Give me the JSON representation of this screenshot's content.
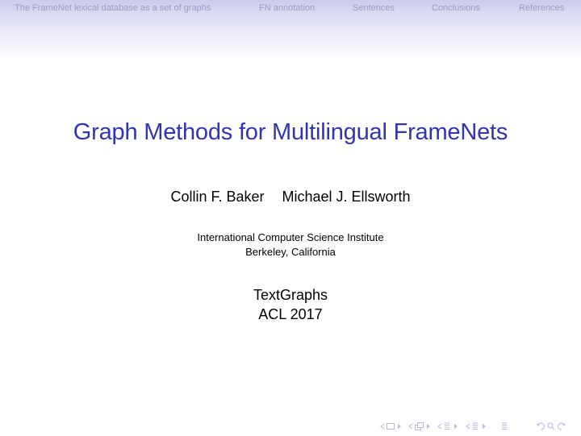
{
  "header": {
    "sections": [
      "The FrameNet lexical database as a set of graphs",
      "FN annotation",
      "Sentences",
      "Conclusions",
      "References"
    ]
  },
  "slide": {
    "title": "Graph Methods for Multilingual FrameNets",
    "authors": [
      "Collin F. Baker",
      "Michael J. Ellsworth"
    ],
    "institution": "International Computer Science Institute",
    "location": "Berkeley, California",
    "event": "TextGraphs",
    "conference": "ACL 2017"
  },
  "navigation_symbols": [
    "frame-prev-icon",
    "frame-icon",
    "frame-next-icon",
    "subsection-prev-icon",
    "subsection-icon",
    "subsection-next-icon",
    "section-prev-icon",
    "section-icon",
    "section-next-icon",
    "slide-prev-icon",
    "slide-icon",
    "slide-next-icon",
    "appendix-icon",
    "back-icon",
    "search-icon",
    "forward-icon"
  ],
  "colors": {
    "title": "#3333b3",
    "header_top": "#cbcbec",
    "nav_text": "#9a9ac6",
    "nav_symbols": "#b8b8e0"
  }
}
